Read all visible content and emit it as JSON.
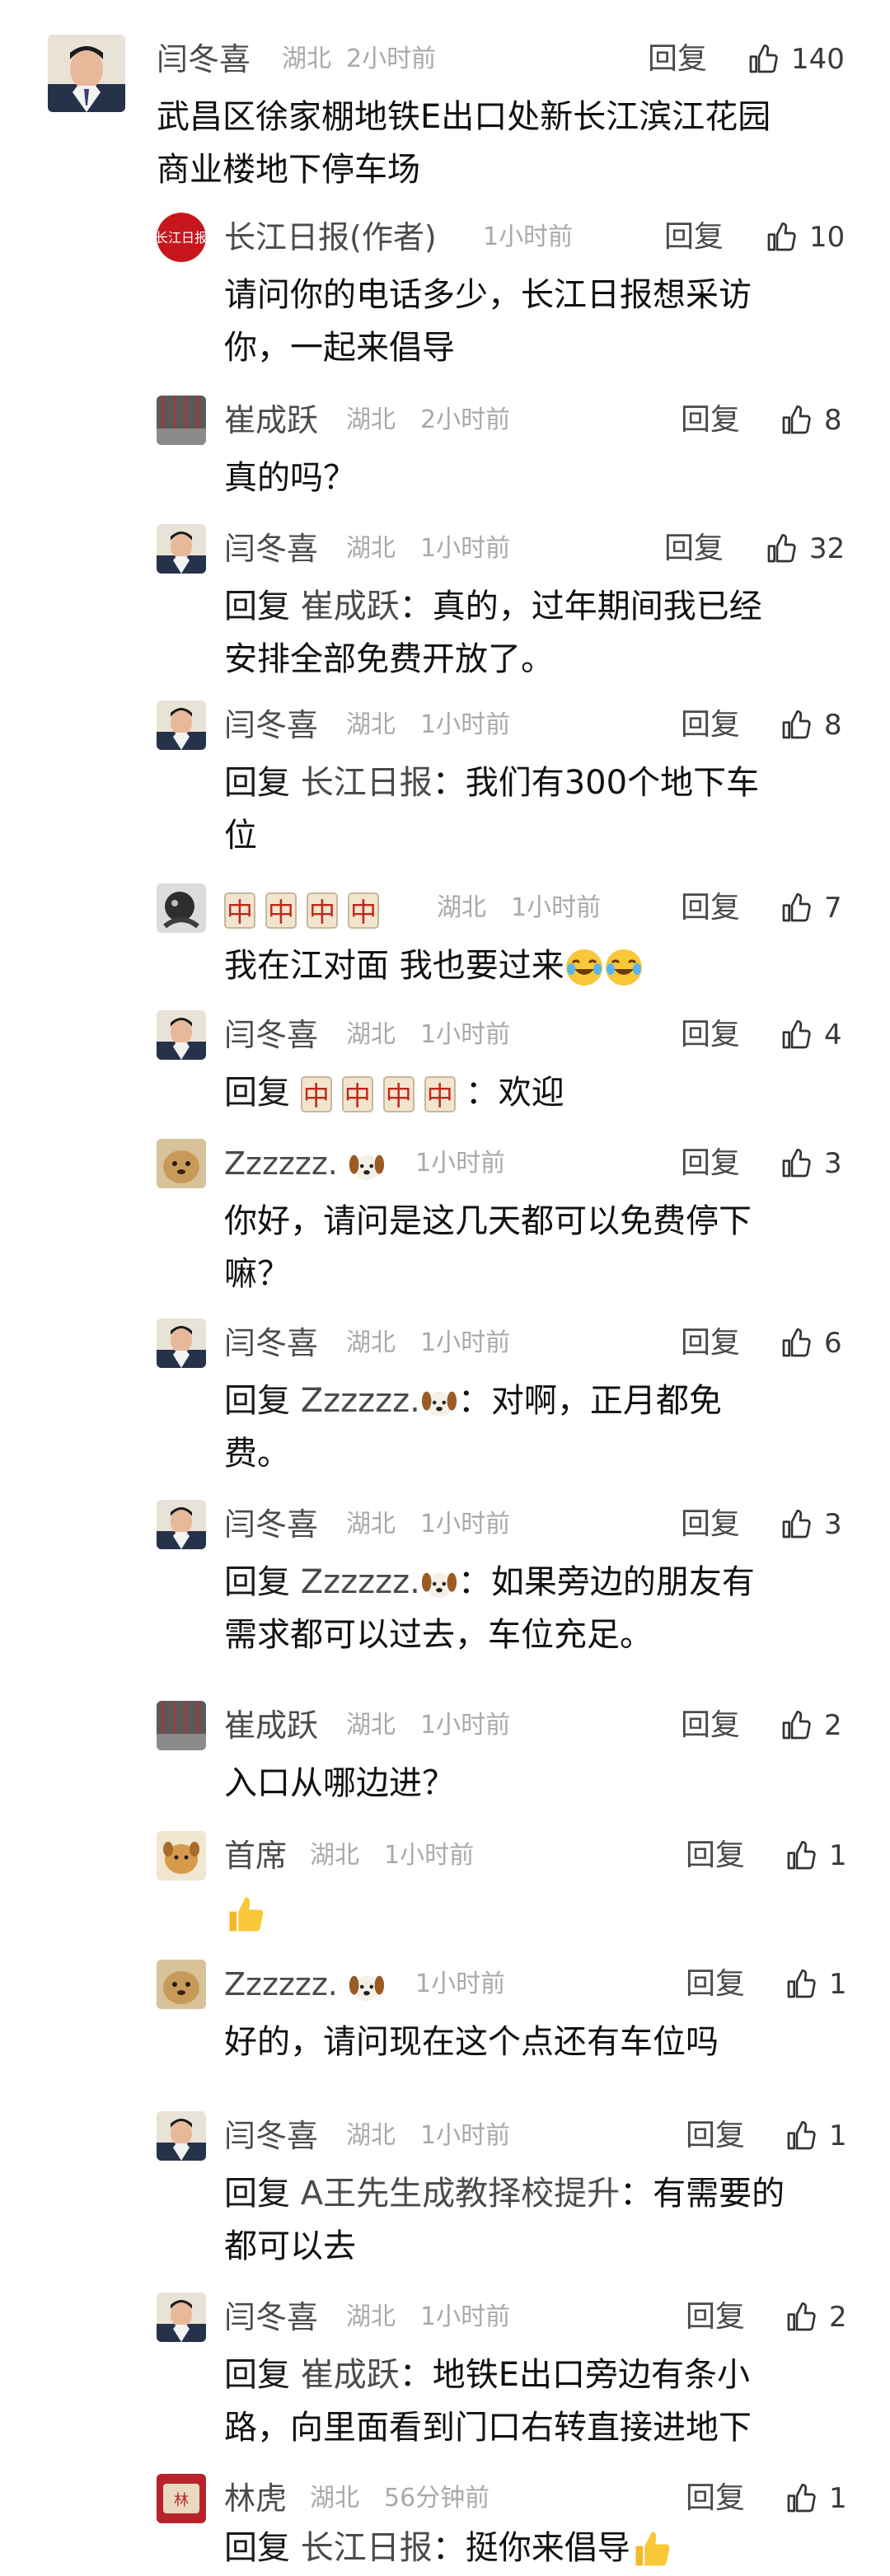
{
  "ui": {
    "reply_label": "回复",
    "reply_prefix": "回复",
    "reply_sep": "："
  },
  "comments": [
    {
      "name": "闫冬喜",
      "location": "湖北",
      "time": "2小时前",
      "likes": "140",
      "text": "武昌区徐家棚地铁E出口处新长江滨江花园\n商业楼地下停车场"
    },
    {
      "name": "长江日报(作者)",
      "location": "",
      "time": "1小时前",
      "likes": "10",
      "text": "请问你的电话多少，长江日报想采访\n你，一起来倡导"
    },
    {
      "name": "崔成跃",
      "location": "湖北",
      "time": "2小时前",
      "likes": "8",
      "text": "真的吗？"
    },
    {
      "name": "闫冬喜",
      "location": "湖北",
      "time": "1小时前",
      "likes": "32",
      "target": "崔成跃",
      "text": "真的，过年期间我已经\n安排全部免费开放了。"
    },
    {
      "name": "闫冬喜",
      "location": "湖北",
      "time": "1小时前",
      "likes": "8",
      "target": "长江日报",
      "text": "我们有300个地下车\n位"
    },
    {
      "name": "🀄🀄🀄🀄",
      "location": "湖北",
      "time": "1小时前",
      "likes": "7",
      "text": "我在江对面 我也要过来"
    },
    {
      "name": "闫冬喜",
      "location": "湖北",
      "time": "1小时前",
      "likes": "4",
      "target": "🀄🀄🀄🀄",
      "text": "欢迎"
    },
    {
      "name": "Zzzzzz.",
      "location": "",
      "time": "1小时前",
      "likes": "3",
      "text": "你好，请问是这几天都可以免费停下\n嘛？"
    },
    {
      "name": "闫冬喜",
      "location": "湖北",
      "time": "1小时前",
      "likes": "6",
      "target": "Zzzzzz.",
      "text": "对啊，正月都免\n费。"
    },
    {
      "name": "闫冬喜",
      "location": "湖北",
      "time": "1小时前",
      "likes": "3",
      "target": "Zzzzzz.",
      "text": "如果旁边的朋友有\n需求都可以过去，车位充足。"
    },
    {
      "name": "崔成跃",
      "location": "湖北",
      "time": "1小时前",
      "likes": "2",
      "text": "入口从哪边进？"
    },
    {
      "name": "首席",
      "location": "湖北",
      "time": "1小时前",
      "likes": "1",
      "text": ""
    },
    {
      "name": "Zzzzzz.",
      "location": "",
      "time": "1小时前",
      "likes": "1",
      "text": "好的，请问现在这个点还有车位吗"
    },
    {
      "name": "闫冬喜",
      "location": "湖北",
      "time": "1小时前",
      "likes": "1",
      "target": "A王先生成教择校提升",
      "text": "有需要的\n都可以去"
    },
    {
      "name": "闫冬喜",
      "location": "湖北",
      "time": "1小时前",
      "likes": "2",
      "target": "崔成跃",
      "text": "地铁E出口旁边有条小\n路，向里面看到门口右转直接进地下"
    },
    {
      "name": "林虎",
      "location": "湖北",
      "time": "56分钟前",
      "likes": "1",
      "target": "长江日报",
      "text": "挺你来倡导"
    }
  ]
}
